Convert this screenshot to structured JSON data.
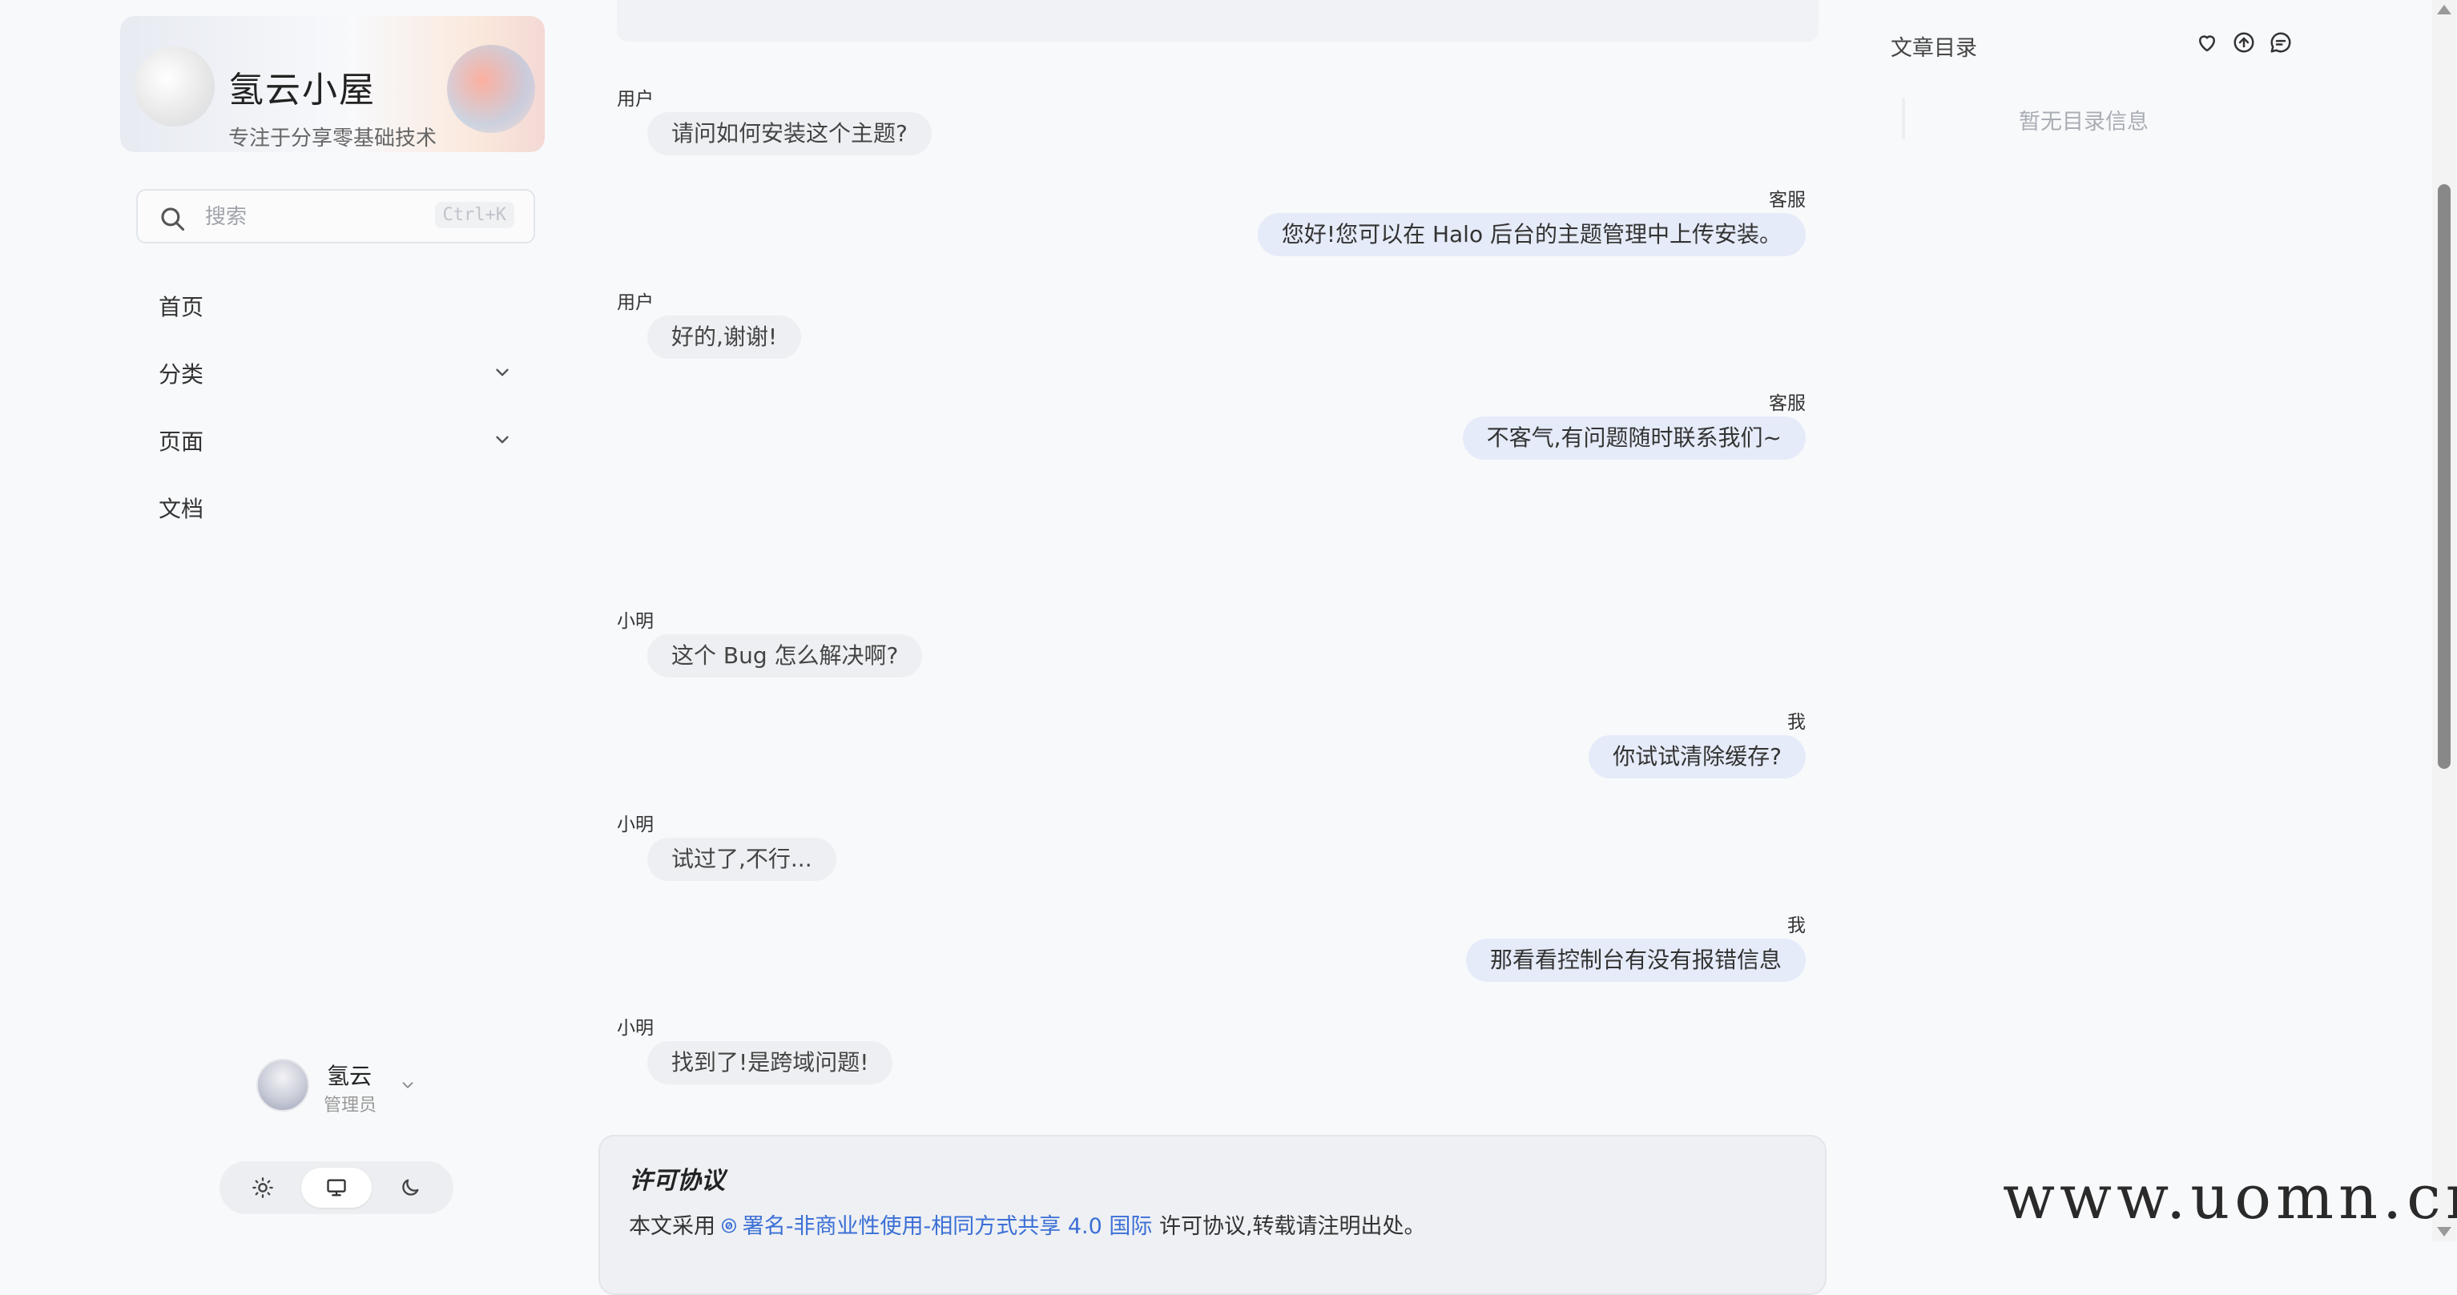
{
  "brand": {
    "title": "氢云小屋",
    "subtitle": "专注于分享零基础技术"
  },
  "search": {
    "placeholder": "搜索",
    "shortcut": "Ctrl+K"
  },
  "nav": {
    "items": [
      {
        "label": "首页",
        "has_submenu": false
      },
      {
        "label": "分类",
        "has_submenu": true
      },
      {
        "label": "页面",
        "has_submenu": true
      },
      {
        "label": "文档",
        "has_submenu": false
      }
    ]
  },
  "user": {
    "name": "氢云",
    "role": "管理员"
  },
  "theme": {
    "options": [
      "light",
      "system",
      "dark"
    ],
    "active": "system"
  },
  "chat": {
    "messages": [
      {
        "sender": "用户",
        "text": "请问如何安装这个主题?",
        "side": "left"
      },
      {
        "sender": "客服",
        "text": "您好!您可以在 Halo 后台的主题管理中上传安装。",
        "side": "right"
      },
      {
        "sender": "用户",
        "text": "好的,谢谢!",
        "side": "left"
      },
      {
        "sender": "客服",
        "text": "不客气,有问题随时联系我们~",
        "side": "right"
      },
      {
        "sender": "小明",
        "text": "这个 Bug 怎么解决啊?",
        "side": "left"
      },
      {
        "sender": "我",
        "text": "你试试清除缓存?",
        "side": "right"
      },
      {
        "sender": "小明",
        "text": "试过了,不行...",
        "side": "left"
      },
      {
        "sender": "我",
        "text": "那看看控制台有没有报错信息",
        "side": "right"
      },
      {
        "sender": "小明",
        "text": "找到了!是跨域问题!",
        "side": "left"
      }
    ]
  },
  "license": {
    "title": "许可协议",
    "prefix": "本文采用 ",
    "link": "署名-非商业性使用-相同方式共享 4.0 国际",
    "suffix": " 许可协议,转载请注明出处。"
  },
  "toc": {
    "title": "文章目录",
    "empty": "暂无目录信息"
  },
  "watermark": "www.uomn.cn",
  "colors": {
    "accent": "#3b6fd6",
    "bubble_right": "#e5ebf8",
    "bubble_left": "#eeeff2",
    "page_bg": "#f8f9fb"
  }
}
